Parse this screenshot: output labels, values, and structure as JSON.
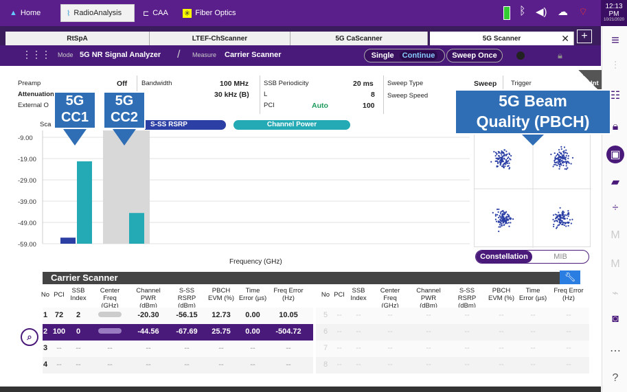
{
  "topbar": {
    "home_label": "Home",
    "radioanalysis_label": "RadioAnalysis",
    "caa_label": "CAA",
    "fiberoptics_label": "Fiber Optics",
    "time": "12:13 PM",
    "date": "10/21/2020"
  },
  "tabs": [
    {
      "label": "RtSpA"
    },
    {
      "label": "LTEF-ChScanner"
    },
    {
      "label": "5G CaScanner"
    },
    {
      "label": "5G Scanner"
    }
  ],
  "moderow": {
    "mode_prefix": "Mode",
    "mode_value": "5G NR Signal Analyzer",
    "measure_prefix": "Measure",
    "measure_value": "Carrier Scanner",
    "single_label": "Single",
    "continue_label": "Continue",
    "sweep_once_label": "Sweep Once"
  },
  "settings": {
    "preamp_label": "Preamp",
    "preamp_value": "Off",
    "attenuation_label": "Attenuation",
    "external_label": "External O",
    "bandwidth_label": "Bandwidth",
    "bandwidth_value": "100 MHz",
    "scs_label": "B",
    "scs_value": "30 kHz (B)",
    "ssb_period_label": "SSB Periodicity",
    "ssb_period_value": "20 ms",
    "l_label": "L",
    "l_value": "8",
    "pci_label": "PCI",
    "pci_mode": "Auto",
    "pci_value": "100",
    "sweep_type_label": "Sweep Type",
    "sweep_type_value": "Sweep",
    "sweep_speed_label": "Sweep Speed",
    "trigger_label": "Trigger",
    "int_label": "Int"
  },
  "chart": {
    "scale_label": "Sca",
    "legend_rsrp": "S-SS RSRP",
    "legend_power": "Channel Power",
    "xlabel": "Frequency (GHz)",
    "yticks": [
      "-9.00",
      "-19.00",
      "-29.00",
      "-39.00",
      "-49.00",
      "-59.00"
    ],
    "constellation_label": "Constellation",
    "mib_label": "MIB"
  },
  "chart_data": {
    "type": "bar",
    "categories": [
      "CC1",
      "CC2"
    ],
    "series": [
      {
        "name": "S-SS RSRP",
        "values": [
          -56.15,
          -67.69
        ]
      },
      {
        "name": "Channel Power",
        "values": [
          -20.3,
          -44.56
        ]
      }
    ],
    "ylim": [
      -59,
      -9
    ],
    "xlabel": "Frequency (GHz)",
    "colors": {
      "rsrp": "#2b3fa5",
      "power": "#24aab5"
    }
  },
  "callouts": {
    "cc1": "5G\nCC1",
    "cc2": "5G\nCC2",
    "beam": "5G Beam\nQuality (PBCH)"
  },
  "table": {
    "title": "Carrier Scanner",
    "headers": [
      "No",
      "PCI",
      "SSB Index",
      "Center Freq (GHz)",
      "Channel PWR (dBm)",
      "S-SS RSRP (dBm)",
      "PBCH EVM (%)",
      "Time Error (µs)",
      "Freq Error (Hz)"
    ],
    "rows": [
      {
        "no": "1",
        "pci": "72",
        "ssb": "2",
        "chpwr": "-20.30",
        "rsrp": "-56.15",
        "evm": "12.73",
        "terr": "0.00",
        "ferr": "10.05"
      },
      {
        "no": "2",
        "pci": "100",
        "ssb": "0",
        "chpwr": "-44.56",
        "rsrp": "-67.69",
        "evm": "25.75",
        "terr": "0.00",
        "ferr": "-504.72"
      },
      {
        "no": "3"
      },
      {
        "no": "4"
      }
    ],
    "right_rows": [
      "5",
      "6",
      "7",
      "8"
    ],
    "dash": "--"
  }
}
